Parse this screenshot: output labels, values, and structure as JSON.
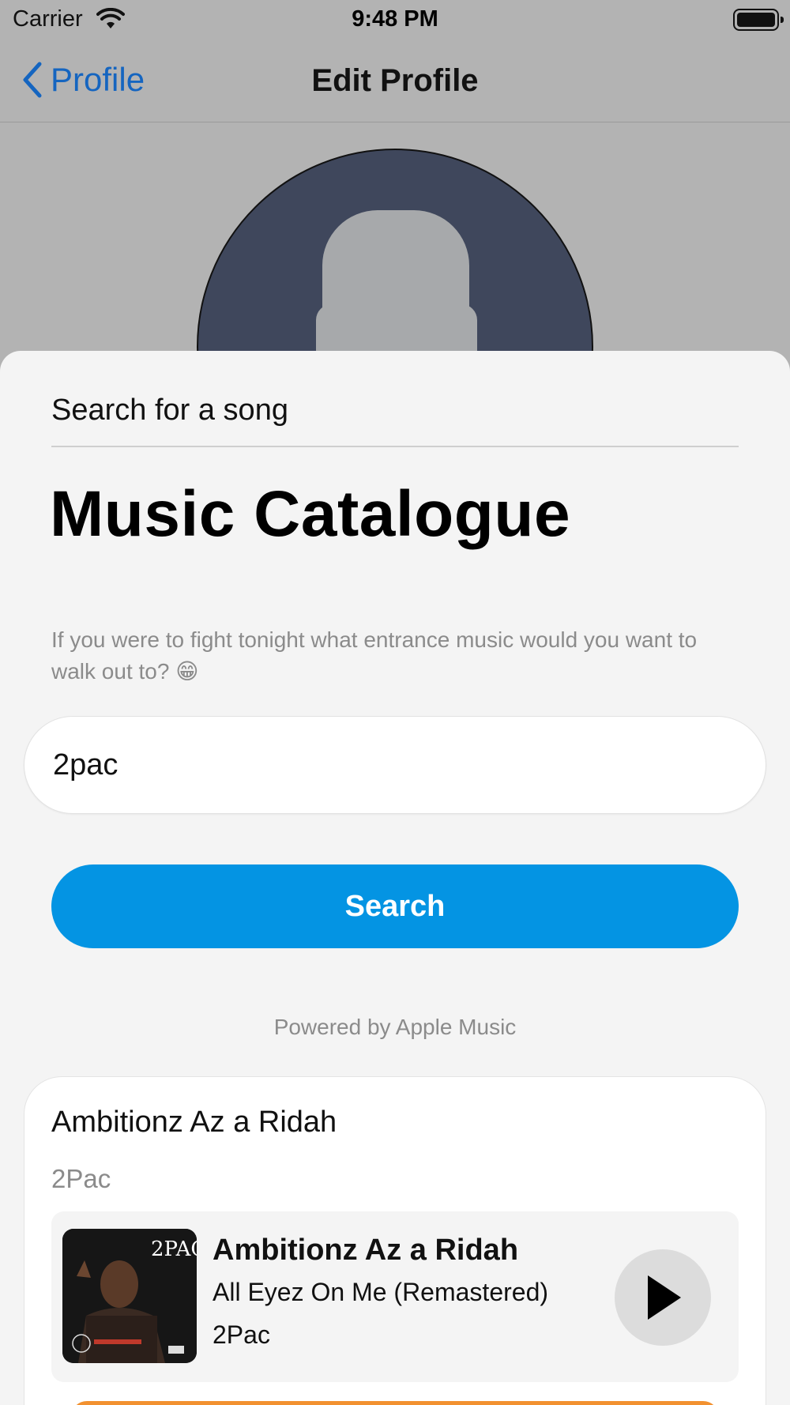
{
  "status_bar": {
    "carrier": "Carrier",
    "time": "9:48 PM"
  },
  "nav": {
    "back_label": "Profile",
    "title": "Edit Profile"
  },
  "sheet": {
    "header": "Search for a song",
    "title": "Music Catalogue",
    "prompt": "If you were to fight tonight what entrance music would you want to walk out to? 😁",
    "search_value": "2pac",
    "search_button": "Search",
    "powered_by": "Powered by Apple Music"
  },
  "result": {
    "title": "Ambitionz Az a Ridah",
    "artist": "2Pac",
    "track": {
      "title": "Ambitionz Az a Ridah",
      "album": "All Eyez On Me (Remastered)",
      "artist": "2Pac",
      "artwork_text": "2PAC"
    }
  },
  "colors": {
    "accent_blue": "#0494e3",
    "link_blue": "#1565c0",
    "orange": "#f29130",
    "sheet_bg": "#f4f4f4",
    "dim_bg": "#b3b3b3"
  },
  "icons": [
    "wifi-icon",
    "battery-icon",
    "chevron-left-icon",
    "avatar-placeholder",
    "play-icon"
  ]
}
